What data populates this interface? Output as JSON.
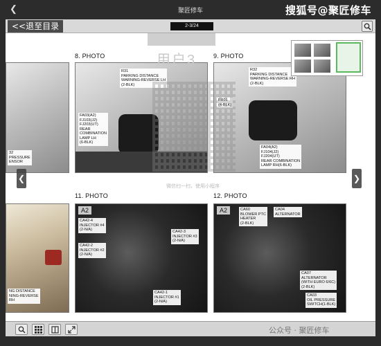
{
  "app": {
    "title": "聚匠修车",
    "watermark": "搜狐号@聚匠修车",
    "bottom_watermark": "公众号 · 聚匠修车"
  },
  "toolbar": {
    "back_label": "<<退至目录",
    "page_indicator": "2-3/24"
  },
  "photos": [
    {
      "title": "8. PHOTO",
      "labels": [
        "R31\nPARKING DISTANCE\nWARNING-REVERSE LH\n(2-BLK)",
        "FA03(A2)\nFJ103(J2)\nFJ203(UT)\nREAR\nCOMBINATION\nLAMP LH\n(6-BLK)"
      ]
    },
    {
      "title": "9. PHOTO",
      "labels": [
        "R32\nPARKING DISTANCE\nWARNING-REVERSE RH\n(2-BLK)",
        "FR01\n(4-BLK)",
        "FA04(A2)\nFJ104(J2)\nFJ204(UT)\nREAR COMBINATION\nLAMP RH(6-BLK)"
      ]
    },
    {
      "title": "11. PHOTO",
      "tag": "A2",
      "labels": [
        "CA42-4\nINJECTOR #4\n(2-N/A)",
        "CA42-3\nINJECTOR #3\n(2-N/A)",
        "CA42-2\nINJECTOR #2\n(2-N/A)",
        "CA42-1\nINJECTOR #1\n(2-N/A)"
      ]
    },
    {
      "title": "12. PHOTO",
      "tag": "A2",
      "labels": [
        "CA60\nBLOWER PTC\nHEATER\n(2-BLK)",
        "CA04\nALTERNATOR",
        "CA07\nALTERNATOR\n(WITH EURO 6/6C)\n(2-BLK)",
        "CA03\nOIL PRESSURE\nSWITCH(1-BLK)"
      ]
    }
  ],
  "partial_left": {
    "top_label": "32\nPRESSURE\nENSOR",
    "bottom_label": "NG DISTANCE\nNING-REVERSE\nRH"
  },
  "faint_overlay": {
    "big_text": "用户3",
    "note": "微信扫一扫，使用小程序"
  },
  "icons": {
    "back": "back-arrow-icon",
    "search": "search-icon",
    "nav_prev": "chevron-left-icon",
    "nav_next": "chevron-right-icon",
    "zoom": "zoom-icon",
    "grid": "grid-icon",
    "book": "book-icon",
    "fullscreen": "fullscreen-icon"
  },
  "colors": {
    "chrome": "#2c2c2c",
    "toolbar": "#d9d9d9",
    "thumb_selection": "#5cb85c"
  }
}
